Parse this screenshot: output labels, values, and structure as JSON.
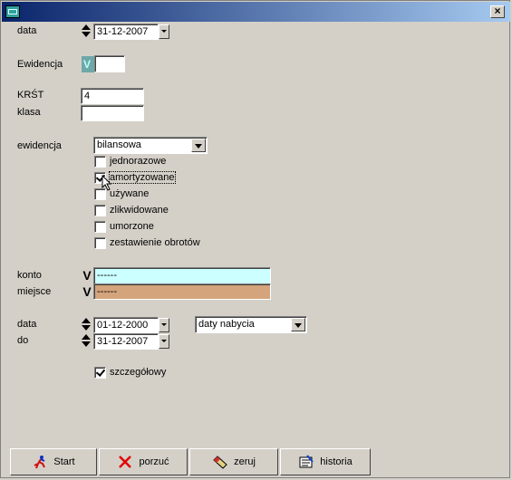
{
  "window": {
    "title": ""
  },
  "form": {
    "data_label": "data",
    "data_value": "31-12-2007",
    "ewidencja_label": "Ewidencja",
    "ewidencja_value": "",
    "krst_label": "KRŚT",
    "krst_value": "4",
    "klasa_label": "klasa",
    "klasa_value": "",
    "ewidencja2_label": "ewidencja",
    "ewidencja2_value": "bilansowa",
    "checkboxes": [
      {
        "label": "jednorazowe",
        "checked": false
      },
      {
        "label": "amortyzowane",
        "checked": true
      },
      {
        "label": "używane",
        "checked": false
      },
      {
        "label": "zlikwidowane",
        "checked": false
      },
      {
        "label": "umorzone",
        "checked": false
      },
      {
        "label": "zestawienie obrotów",
        "checked": false
      }
    ],
    "konto_label": "konto",
    "konto_value": "------",
    "miejsce_label": "miejsce",
    "miejsce_value": "------",
    "data_from_label": "data",
    "data_from_value": "01-12-2000",
    "data_to_label": "do",
    "data_to_value": "31-12-2007",
    "date_type_value": "daty nabycia",
    "szczegolowy_label": "szczegółowy",
    "szczegolowy_checked": true
  },
  "buttons": {
    "start": "Start",
    "porzuc": "porzuć",
    "zeruj": "zeruj",
    "historia": "historia"
  },
  "colors": {
    "konto_bg": "#ccffff",
    "miejsce_bg": "#d4a47c",
    "ewid_btn": "#6fa8a8"
  }
}
